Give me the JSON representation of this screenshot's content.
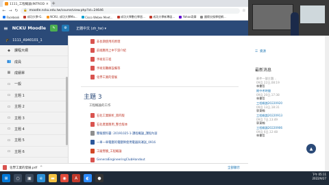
{
  "browser": {
    "tab_title": "1111_工程概論(INTRODU...",
    "url": "moodle.ncku.edu.tw/course/view.php?id=24646",
    "bookmarks": [
      "Facebook",
      "成功大學-G.",
      "NCKU, 成功大學Ma...",
      "Cisco Webex Meet...",
      "成功大學數位學習...",
      "成功大學新專區...",
      "Yahoo奇摩",
      "國際交換學程網..."
    ]
  },
  "navbar": {
    "brand": "NCKU Moodle",
    "lang": "正體中文 (zh_tw) ▾"
  },
  "sidebar": {
    "course": "1111_A940101_1",
    "items": [
      "課程大綱",
      "成員",
      "成績單",
      "一般",
      "主題 1",
      "主題 2",
      "主題 3",
      "主題 4",
      "主題 5",
      "主題 6"
    ]
  },
  "main": {
    "activities_above": [
      {
        "label": "非長期使用的原理",
        "type": "pdf"
      },
      {
        "label": "前端應用上中下游介紹",
        "type": "pdf"
      },
      {
        "label": "手術房工程",
        "type": "pdf"
      },
      {
        "label": "手術房醫療設備等",
        "type": "pdf"
      },
      {
        "label": "化學工業的發展",
        "type": "pdf"
      }
    ],
    "topic_title": "主題 3",
    "topic_subtitle": "工程概論的工作",
    "activities_below": [
      {
        "label": "石化工業解析_第四版",
        "type": "pdf"
      },
      {
        "label": "石化產業應用_整合版本",
        "type": "pdf"
      },
      {
        "label": "簡報資料書: 20191025-1-課程概論_課程內容",
        "type": "gen"
      },
      {
        "label": "一車一車電壓的電壓降使用電器與運送_0916",
        "type": "word"
      },
      {
        "label": "工廠實驗_工程概論",
        "type": "ppt"
      },
      {
        "label": "GeneralEngineeringClubHandout",
        "type": "pdf"
      }
    ]
  },
  "right": {
    "link": "資源",
    "title": "最新消息",
    "news": [
      {
        "subject": "郵件一號主題...",
        "date": "09月 22日,08:19",
        "author": "林書哲"
      },
      {
        "subject": "期中考時間",
        "date": "09月 20日,17:38",
        "author": "林書哲"
      },
      {
        "subject": "工程概論20220920",
        "date": "09月 13日,18:31",
        "author": "郭東翰"
      },
      {
        "subject": "工程概論20220913",
        "date": "09月 7日,13:49",
        "author": "郭東翰"
      },
      {
        "subject": "工程概論20220906",
        "date": "09月 6日,12:48",
        "author": "林書哲"
      }
    ]
  },
  "download": {
    "file": "化學工業的發展.pdf",
    "show_all": "全部顯示"
  },
  "tray": {
    "time": "下午 05:11",
    "date": "2022/9/27"
  }
}
